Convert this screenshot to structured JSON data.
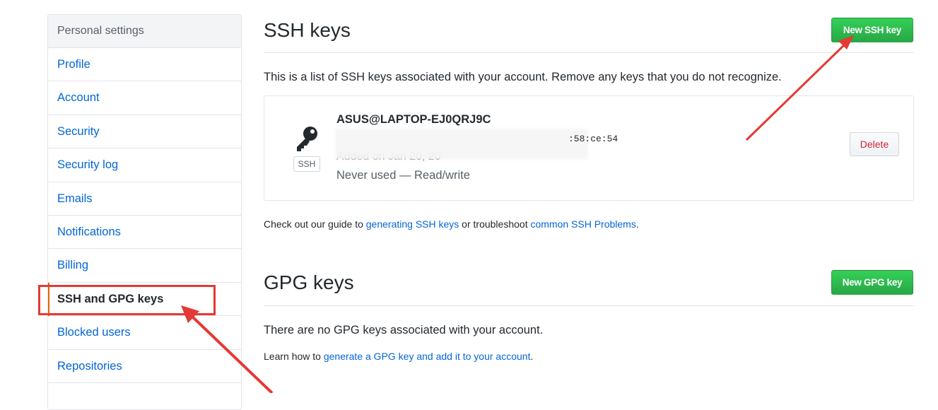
{
  "sidebar": {
    "header": "Personal settings",
    "items": [
      {
        "label": "Profile"
      },
      {
        "label": "Account"
      },
      {
        "label": "Security"
      },
      {
        "label": "Security log"
      },
      {
        "label": "Emails"
      },
      {
        "label": "Notifications"
      },
      {
        "label": "Billing"
      },
      {
        "label": "SSH and GPG keys",
        "selected": true
      },
      {
        "label": "Blocked users"
      },
      {
        "label": "Repositories"
      }
    ]
  },
  "ssh": {
    "title": "SSH keys",
    "new_button": "New SSH key",
    "description": "This is a list of SSH keys associated with your account. Remove any keys that you do not recognize.",
    "key": {
      "label": "SSH",
      "title": "ASUS@LAPTOP-EJ0QRJ9C",
      "fingerprint_partial": ":58:ce:54",
      "added_partial": "Added on Jan 20, 20",
      "usage": "Never used — Read/write",
      "delete_label": "Delete"
    },
    "guide_prefix": "Check out our guide to ",
    "guide_link": "generating SSH keys",
    "guide_middle": " or troubleshoot ",
    "troubleshoot_link": "common SSH Problems",
    "guide_suffix": "."
  },
  "gpg": {
    "title": "GPG keys",
    "new_button": "New GPG key",
    "empty_text": "There are no GPG keys associated with your account.",
    "learn_prefix": "Learn how to ",
    "learn_link": "generate a GPG key and add it to your account",
    "learn_suffix": "."
  },
  "colors": {
    "accent_green": "#28a745",
    "link_blue": "#0366d6",
    "annotation_red": "#e53935",
    "danger_red": "#cb2431"
  }
}
